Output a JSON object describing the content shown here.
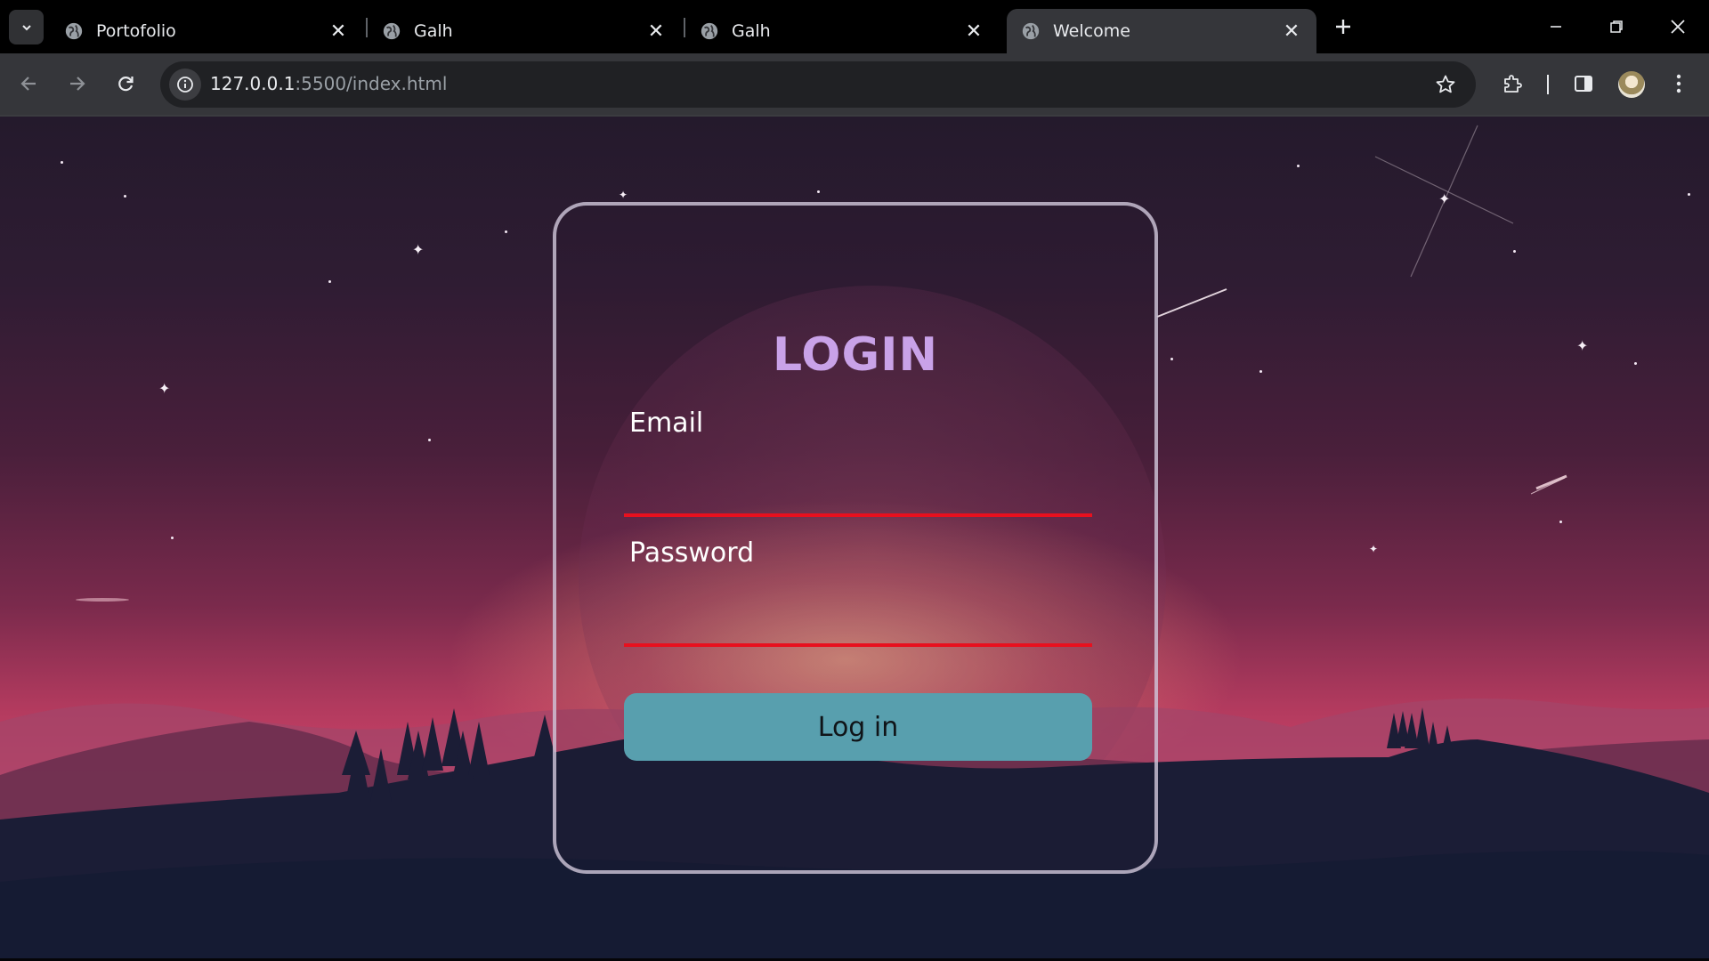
{
  "browser": {
    "tabs": [
      {
        "title": "Portofolio",
        "active": false
      },
      {
        "title": "Galh",
        "active": false
      },
      {
        "title": "Galh",
        "active": false
      },
      {
        "title": "Welcome",
        "active": true
      }
    ],
    "address": {
      "host": "127.0.0.1",
      "rest": ":5500/index.html"
    },
    "icons": {
      "tab_search": "chevron-down-icon",
      "favicon": "globe-icon",
      "close": "close-icon",
      "new_tab": "plus-icon",
      "minimize": "minimize-icon",
      "restore": "restore-icon",
      "window_close": "close-icon",
      "back": "arrow-left-icon",
      "forward": "arrow-right-icon",
      "reload": "reload-icon",
      "site_info": "info-icon",
      "bookmark": "star-icon",
      "extensions": "puzzle-icon",
      "side_panel": "side-panel-icon",
      "profile": "avatar",
      "menu": "kebab-menu-icon"
    }
  },
  "login": {
    "title": "LOGIN",
    "email_label": "Email",
    "email_value": "",
    "password_label": "Password",
    "password_value": "",
    "submit_label": "Log in"
  },
  "colors": {
    "title": "#c9a2e8",
    "input_underline": "#e8101e",
    "button": "#589fae",
    "card_border": "#d2c8dc"
  }
}
